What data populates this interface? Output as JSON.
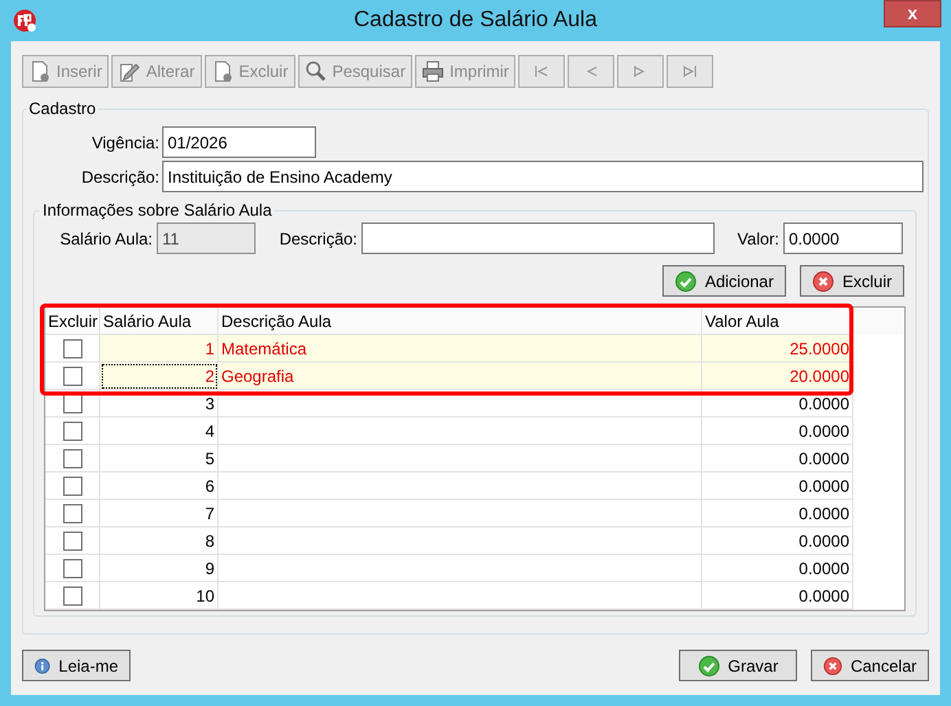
{
  "window": {
    "title": "Cadastro de Salário Aula",
    "close": "x"
  },
  "toolbar": [
    {
      "kind": "insert",
      "label": "Inserir",
      "disabled": true
    },
    {
      "kind": "edit",
      "label": "Alterar",
      "disabled": true
    },
    {
      "kind": "delete",
      "label": "Excluir",
      "disabled": true
    },
    {
      "kind": "search",
      "label": "Pesquisar",
      "disabled": true
    },
    {
      "kind": "print",
      "label": "Imprimir",
      "disabled": true
    },
    {
      "kind": "first",
      "disabled": true
    },
    {
      "kind": "prev",
      "disabled": true
    },
    {
      "kind": "next",
      "disabled": true
    },
    {
      "kind": "last",
      "disabled": true
    }
  ],
  "cadastro": {
    "title": "Cadastro",
    "vigencia_label": "Vigência:",
    "vigencia": "01/2026",
    "descricao_label": "Descrição:",
    "descricao": "Instituição de Ensino Academy"
  },
  "info": {
    "title": "Informações sobre Salário Aula",
    "salario_label": "Salário Aula:",
    "salario": "11",
    "descricao_label": "Descrição:",
    "valor_label": "Valor:",
    "valor": "0.0000",
    "add_button": "Adicionar",
    "delete_button": "Excluir"
  },
  "table": {
    "columns": [
      "Excluir",
      "Salário Aula",
      "Descrição Aula",
      "Valor Aula"
    ],
    "rows": [
      {
        "checked": false,
        "highlighted": true,
        "focused": false,
        "salario": "1",
        "descricao": "Matemática",
        "valor": "25.0000"
      },
      {
        "checked": false,
        "highlighted": true,
        "focused": true,
        "salario": "2",
        "descricao": "Geografia",
        "valor": "20.0000"
      },
      {
        "checked": false,
        "highlighted": false,
        "focused": false,
        "salario": "3",
        "valor": "0.0000"
      },
      {
        "checked": false,
        "highlighted": false,
        "focused": false,
        "salario": "4",
        "valor": "0.0000"
      },
      {
        "checked": false,
        "highlighted": false,
        "focused": false,
        "salario": "5",
        "valor": "0.0000"
      },
      {
        "checked": false,
        "highlighted": false,
        "focused": false,
        "salario": "6",
        "valor": "0.0000"
      },
      {
        "checked": false,
        "highlighted": false,
        "focused": false,
        "salario": "7",
        "valor": "0.0000"
      },
      {
        "checked": false,
        "highlighted": false,
        "focused": false,
        "salario": "8",
        "valor": "0.0000"
      },
      {
        "checked": false,
        "highlighted": false,
        "focused": false,
        "salario": "9",
        "valor": "0.0000"
      },
      {
        "checked": false,
        "highlighted": false,
        "focused": false,
        "salario": "10",
        "valor": "0.0000"
      }
    ]
  },
  "footer": {
    "readme": "Leia-me",
    "save": "Gravar",
    "cancel": "Cancelar"
  }
}
